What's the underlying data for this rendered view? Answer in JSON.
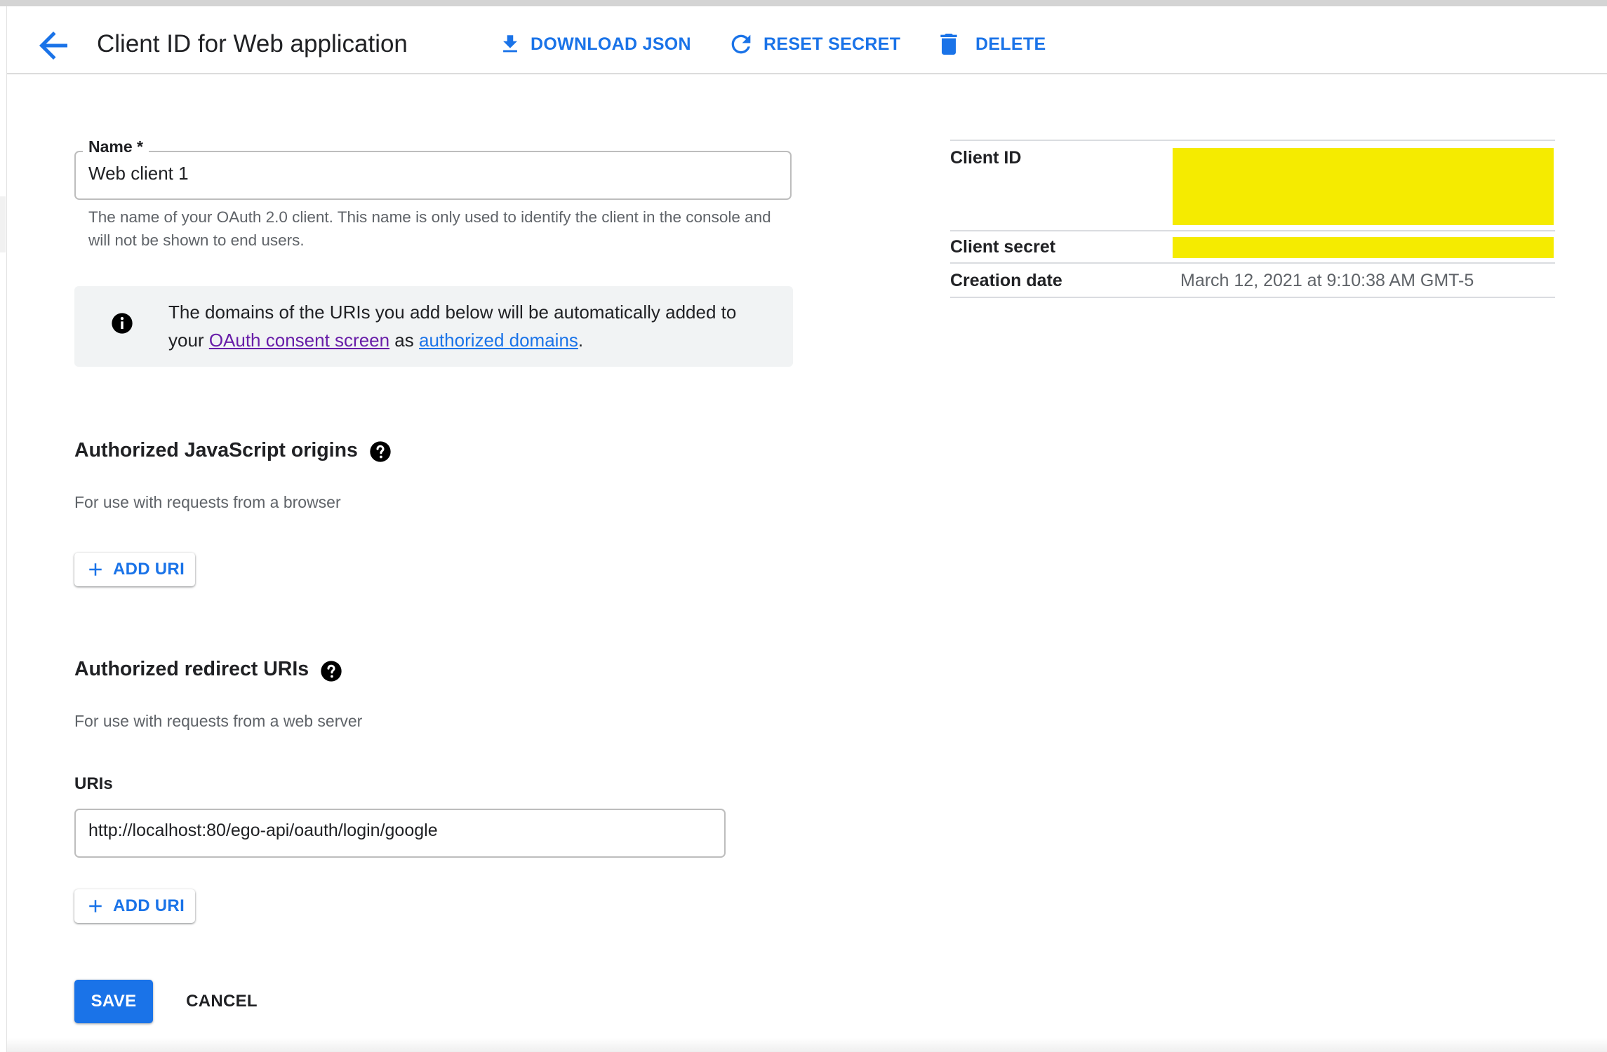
{
  "header": {
    "title": "Client ID for Web application",
    "download_label": "DOWNLOAD JSON",
    "reset_label": "RESET SECRET",
    "delete_label": "DELETE"
  },
  "name_field": {
    "label": "Name *",
    "value": "Web client 1",
    "hint": "The name of your OAuth 2.0 client. This name is only used to identify the client in the console and will not be shown to end users."
  },
  "info_banner": {
    "text_before": "The domains of the URIs you add below will be automatically added to your ",
    "link1": "OAuth consent screen",
    "text_mid": " as ",
    "link2": "authorized domains",
    "text_after": "."
  },
  "js_origins": {
    "title": "Authorized JavaScript origins",
    "description": "For use with requests from a browser",
    "add_label": "ADD URI"
  },
  "redirect_uris": {
    "title": "Authorized redirect URIs",
    "description": "For use with requests from a web server",
    "uris_label": "URIs",
    "uri_value": "http://localhost:80/ego-api/oauth/login/google",
    "add_label": "ADD URI"
  },
  "actions": {
    "save_label": "SAVE",
    "cancel_label": "CANCEL"
  },
  "client_info": {
    "client_id_label": "Client ID",
    "client_secret_label": "Client secret",
    "creation_date_label": "Creation date",
    "creation_date_value": "March 12, 2021 at 9:10:38 AM GMT-5"
  },
  "colors": {
    "accent": "#1a73e8",
    "visited_link": "#681da8",
    "redaction": "#f5eb00"
  },
  "icons": [
    "arrow-back-icon",
    "download-icon",
    "refresh-icon",
    "trash-icon",
    "info-icon",
    "help-icon",
    "plus-icon"
  ]
}
